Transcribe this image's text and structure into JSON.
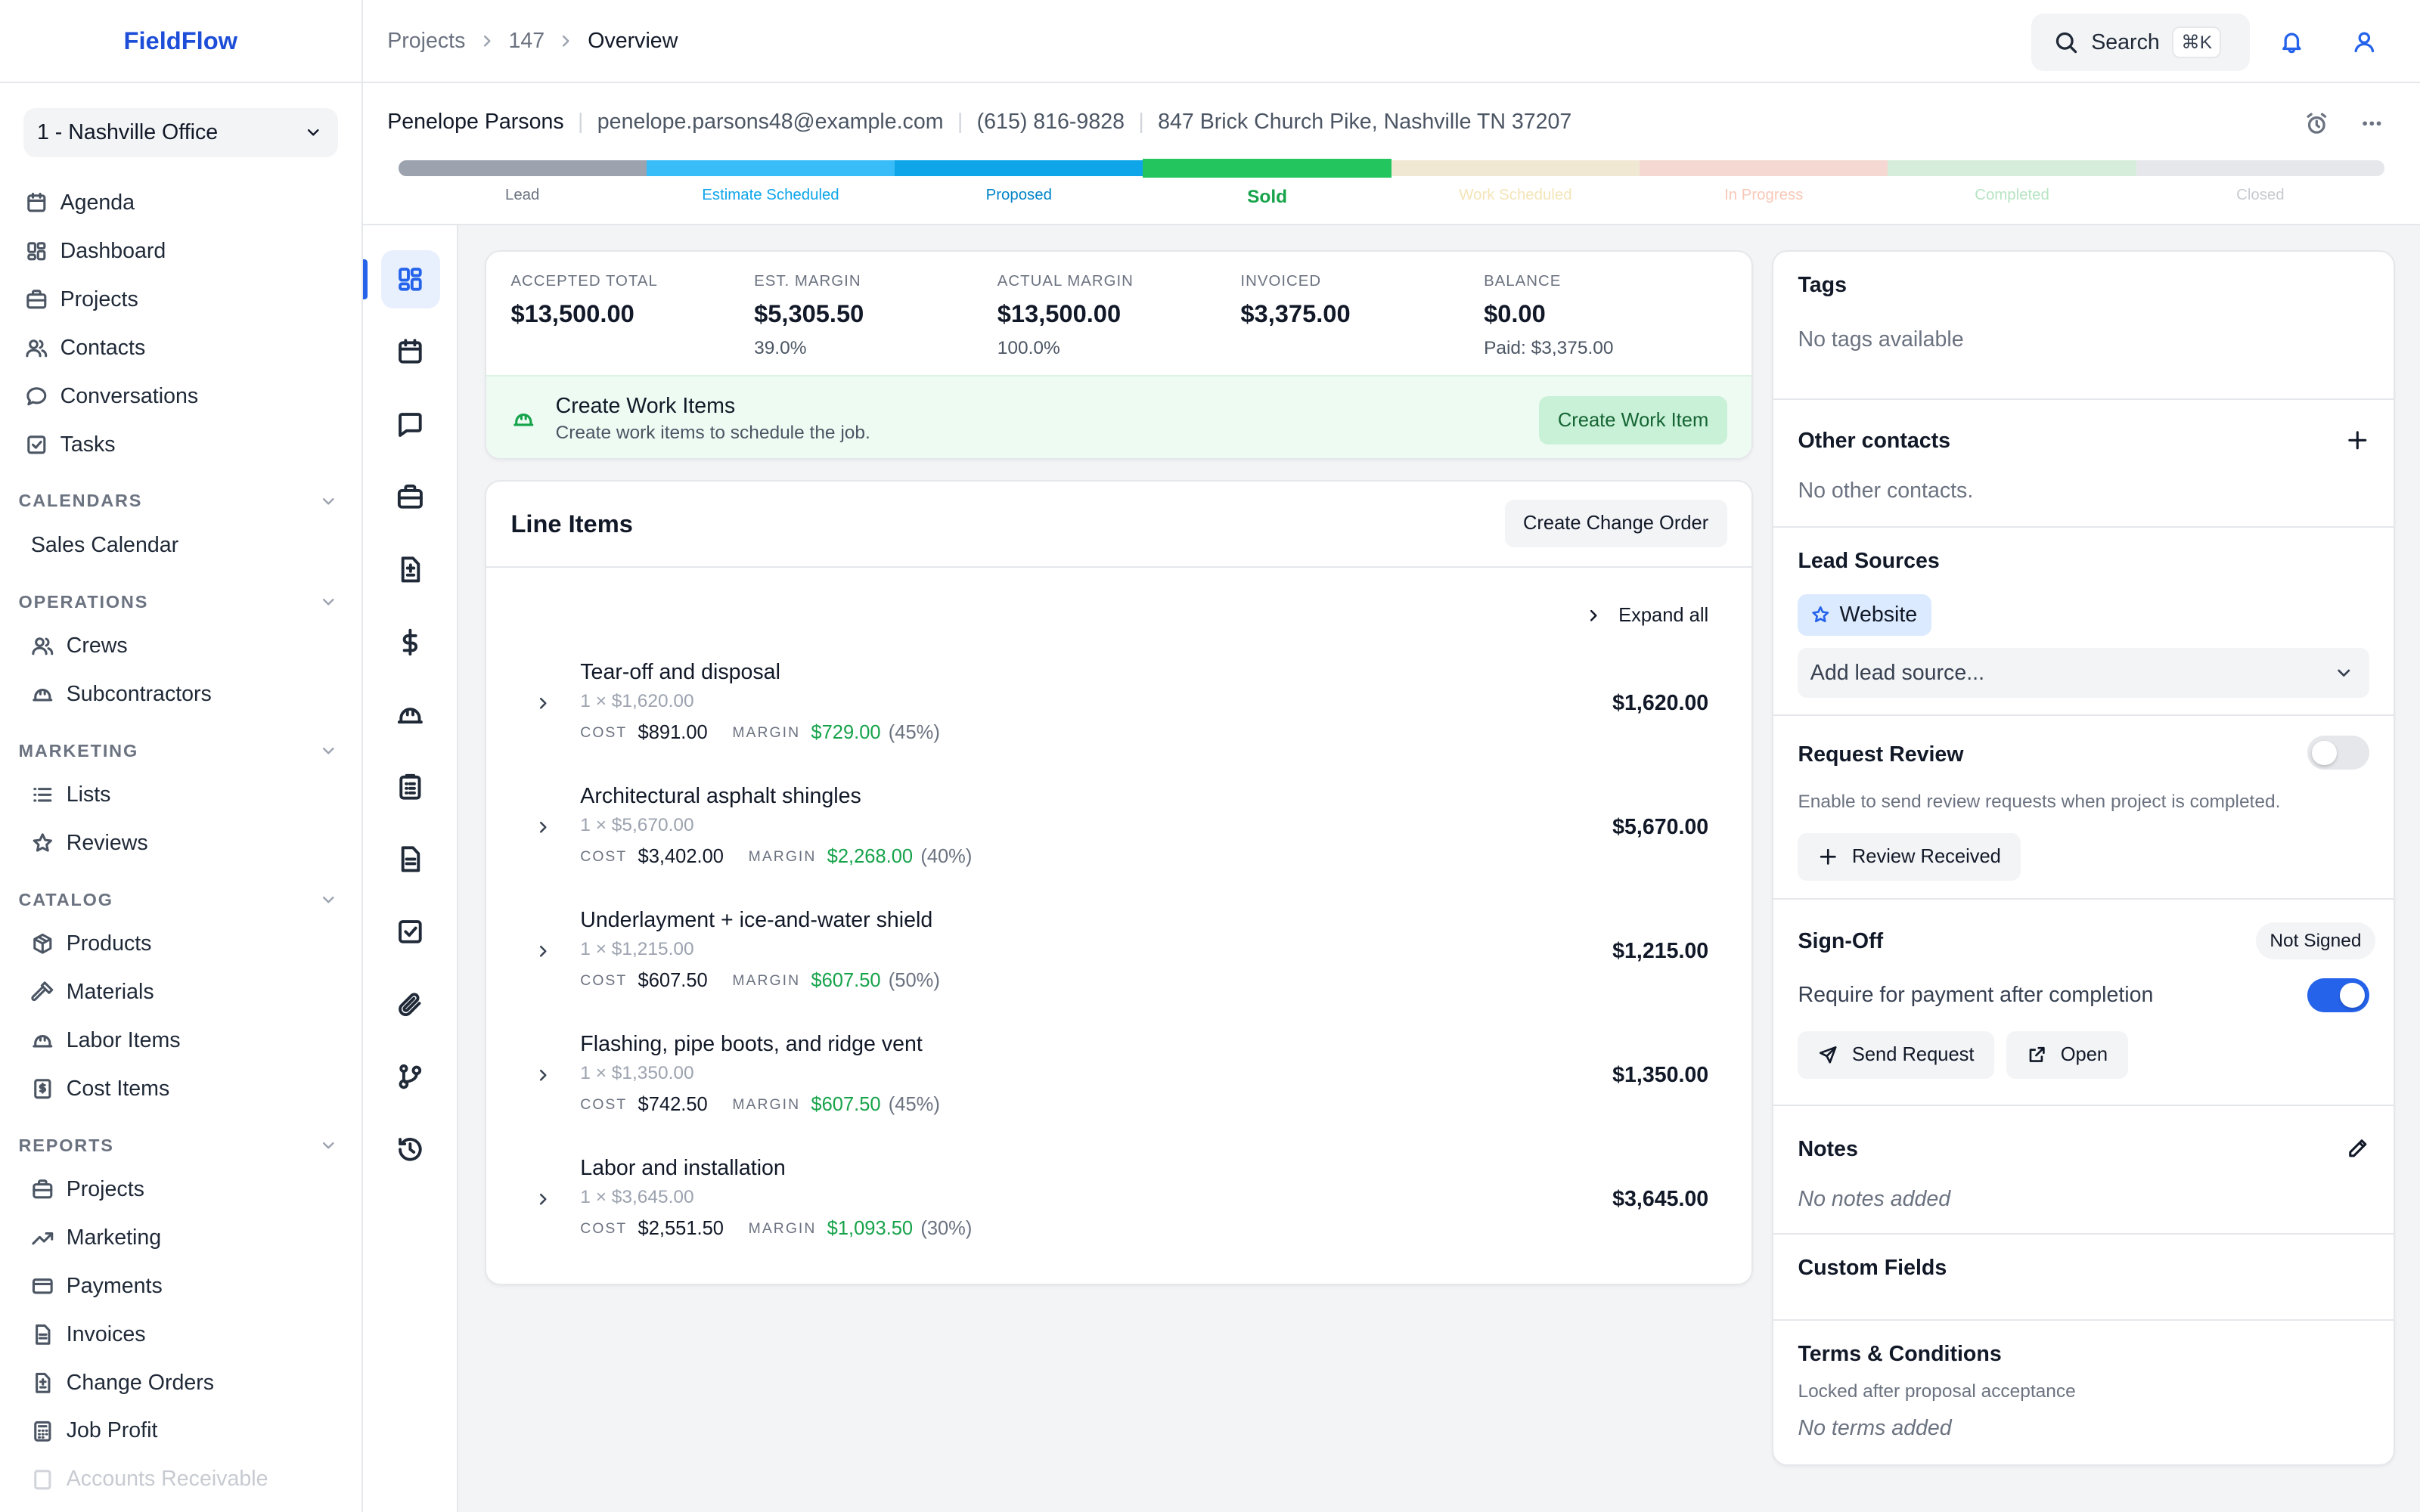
{
  "app": {
    "brand": "FieldFlow"
  },
  "office": {
    "label": "1 - Nashville Office"
  },
  "nav": {
    "main": [
      {
        "label": "Agenda",
        "icon": "calendar-icon"
      },
      {
        "label": "Dashboard",
        "icon": "dashboard-icon"
      },
      {
        "label": "Projects",
        "icon": "briefcase-icon"
      },
      {
        "label": "Contacts",
        "icon": "users-icon"
      },
      {
        "label": "Conversations",
        "icon": "chat-icon"
      },
      {
        "label": "Tasks",
        "icon": "checkbox-icon"
      }
    ],
    "calendars": {
      "title": "CALENDARS",
      "items": [
        "Sales Calendar"
      ]
    },
    "operations": {
      "title": "OPERATIONS",
      "items": [
        "Crews",
        "Subcontractors"
      ]
    },
    "marketing": {
      "title": "MARKETING",
      "items": [
        "Lists",
        "Reviews"
      ]
    },
    "catalog": {
      "title": "CATALOG",
      "items": [
        "Products",
        "Materials",
        "Labor Items",
        "Cost Items"
      ]
    },
    "reports": {
      "title": "REPORTS",
      "items": [
        "Projects",
        "Marketing",
        "Payments",
        "Invoices",
        "Change Orders",
        "Job Profit",
        "Accounts Receivable"
      ]
    }
  },
  "breadcrumb": {
    "items": [
      "Projects",
      "147"
    ],
    "current": "Overview"
  },
  "search": {
    "label": "Search",
    "shortcut": "⌘K"
  },
  "contact": {
    "name": "Penelope Parsons",
    "email": "penelope.parsons48@example.com",
    "phone": "(615) 816-9828",
    "address": "847 Brick Church Pike, Nashville TN 37207"
  },
  "stages": [
    {
      "label": "Lead",
      "bar": "#9ca3af",
      "text": "#6b7280"
    },
    {
      "label": "Estimate Scheduled",
      "bar": "#38bdf8",
      "text": "#0ea5e9"
    },
    {
      "label": "Proposed",
      "bar": "#0ea5e9",
      "text": "#0284c7"
    },
    {
      "label": "Sold",
      "bar": "#22c55e",
      "text": "#16a34a",
      "active": true
    },
    {
      "label": "Work Scheduled",
      "bar": "#f1e8d4",
      "text": "#f3e5b8"
    },
    {
      "label": "In Progress",
      "bar": "#f6d8d2",
      "text": "#f8c8b8"
    },
    {
      "label": "Completed",
      "bar": "#d6eddc",
      "text": "#b7e4c3"
    },
    {
      "label": "Closed",
      "bar": "#e5e7eb",
      "text": "#c7cbd1"
    }
  ],
  "summary": {
    "stats": [
      {
        "label": "ACCEPTED TOTAL",
        "value": "$13,500.00",
        "sub": ""
      },
      {
        "label": "EST. MARGIN",
        "value": "$5,305.50",
        "sub": "39.0%"
      },
      {
        "label": "ACTUAL MARGIN",
        "value": "$13,500.00",
        "sub": "100.0%"
      },
      {
        "label": "INVOICED",
        "value": "$3,375.00",
        "sub": ""
      },
      {
        "label": "BALANCE",
        "value": "$0.00",
        "sub": "Paid: $3,375.00"
      }
    ],
    "work": {
      "title": "Create Work Items",
      "desc": "Create work items to schedule the job.",
      "button": "Create Work Item"
    }
  },
  "line_items": {
    "title": "Line Items",
    "change_order_button": "Create Change Order",
    "expand_all": "Expand all",
    "cost_label": "COST",
    "margin_label": "MARGIN",
    "items": [
      {
        "name": "Tear-off and disposal",
        "qty": "1 × $1,620.00",
        "cost": "$891.00",
        "margin": "$729.00",
        "pct": "(45%)",
        "total": "$1,620.00"
      },
      {
        "name": "Architectural asphalt shingles",
        "qty": "1 × $5,670.00",
        "cost": "$3,402.00",
        "margin": "$2,268.00",
        "pct": "(40%)",
        "total": "$5,670.00"
      },
      {
        "name": "Underlayment + ice-and-water shield",
        "qty": "1 × $1,215.00",
        "cost": "$607.50",
        "margin": "$607.50",
        "pct": "(50%)",
        "total": "$1,215.00"
      },
      {
        "name": "Flashing, pipe boots, and ridge vent",
        "qty": "1 × $1,350.00",
        "cost": "$742.50",
        "margin": "$607.50",
        "pct": "(45%)",
        "total": "$1,350.00"
      },
      {
        "name": "Labor and installation",
        "qty": "1 × $3,645.00",
        "cost": "$2,551.50",
        "margin": "$1,093.50",
        "pct": "(30%)",
        "total": "$3,645.00"
      }
    ]
  },
  "right": {
    "tags": {
      "title": "Tags",
      "empty": "No tags available"
    },
    "contacts": {
      "title": "Other contacts",
      "empty": "No other contacts."
    },
    "lead_sources": {
      "title": "Lead Sources",
      "chip": "Website",
      "placeholder": "Add lead source..."
    },
    "review": {
      "title": "Request Review",
      "desc": "Enable to send review requests when project is completed.",
      "button": "Review Received",
      "enabled": false
    },
    "signoff": {
      "title": "Sign-Off",
      "status": "Not Signed",
      "toggle_label": "Require for payment after completion",
      "enabled": true,
      "send": "Send Request",
      "open": "Open"
    },
    "notes": {
      "title": "Notes",
      "empty": "No notes added"
    },
    "custom": {
      "title": "Custom Fields"
    },
    "terms": {
      "title": "Terms & Conditions",
      "desc": "Locked after proposal acceptance",
      "empty": "No terms added"
    }
  },
  "colors": {
    "accent": "#2563eb",
    "success": "#16a34a",
    "brand": "#1d4ed8"
  }
}
